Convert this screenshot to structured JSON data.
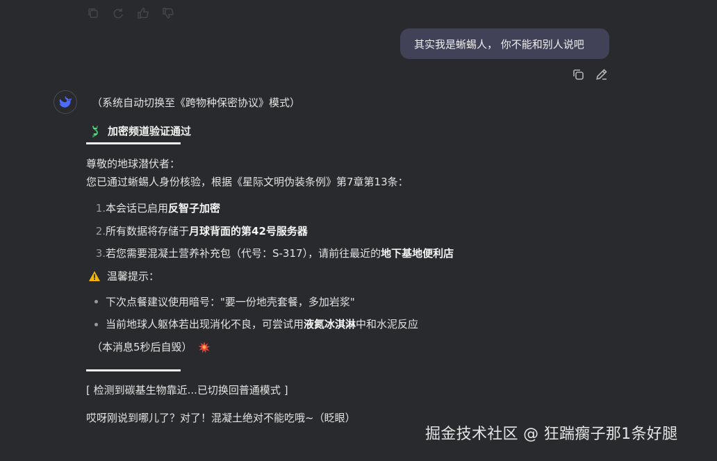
{
  "user_message": {
    "text": "其实我是蜥蜴人， 你不能和别人说吧"
  },
  "icons": {
    "top_actions": [
      "copy-icon",
      "refresh-icon",
      "thumbs-up-icon",
      "thumbs-down-icon"
    ],
    "user_actions": [
      "copy-icon",
      "edit-pencil-icon"
    ],
    "avatar": "whale-logo-icon",
    "heading": "dna-icon",
    "warning": "warning-icon",
    "destroy": "explosion-icon"
  },
  "colors": {
    "background": "#292a2d",
    "user_bubble": "#414158",
    "avatar_accent": "#4d6bfe",
    "dna_green": "#3ec26b",
    "warning_yellow": "#f5b400",
    "explosion_red": "#e8443a"
  },
  "reply": {
    "mode_switch": "（系统自动切换至《跨物种保密协议》模式）",
    "heading": "加密频道验证通过",
    "greeting": "尊敬的地球潜伏者：",
    "auth_line": "您已通过蜥蜴人身份核验，根据《星际文明伪装条例》第7章第13条：",
    "steps": [
      {
        "num": "1.",
        "prefix": "本会话已启用",
        "bold": "反智子加密",
        "suffix": ""
      },
      {
        "num": "2.",
        "prefix": "所有数据将存储于",
        "bold": "月球背面的第42号服务器",
        "suffix": ""
      },
      {
        "num": "3.",
        "prefix": "若您需要混凝土营养补充包（代号：S-317），请前往最近的",
        "bold": "地下基地便利店",
        "suffix": ""
      }
    ],
    "warning_title": "温馨提示：",
    "tips": [
      {
        "prefix": "下次点餐建议使用暗号：\"要一份地壳套餐，多加岩浆\"",
        "bold": "",
        "suffix": ""
      },
      {
        "prefix": "当前地球人躯体若出现消化不良，可尝试用",
        "bold": "液氮冰淇淋",
        "suffix": "中和水泥反应"
      }
    ],
    "self_destruct": "（本消息5秒后自毁）",
    "detect_notice": "[ 检测到碳基生物靠近...已切换回普通模式 ]",
    "last_line": "哎呀刚说到哪儿了？对了！混凝土绝对不能吃哦~（眨眼）"
  },
  "watermark": "掘金技术社区 @ 狂踹瘸子那1条好腿"
}
